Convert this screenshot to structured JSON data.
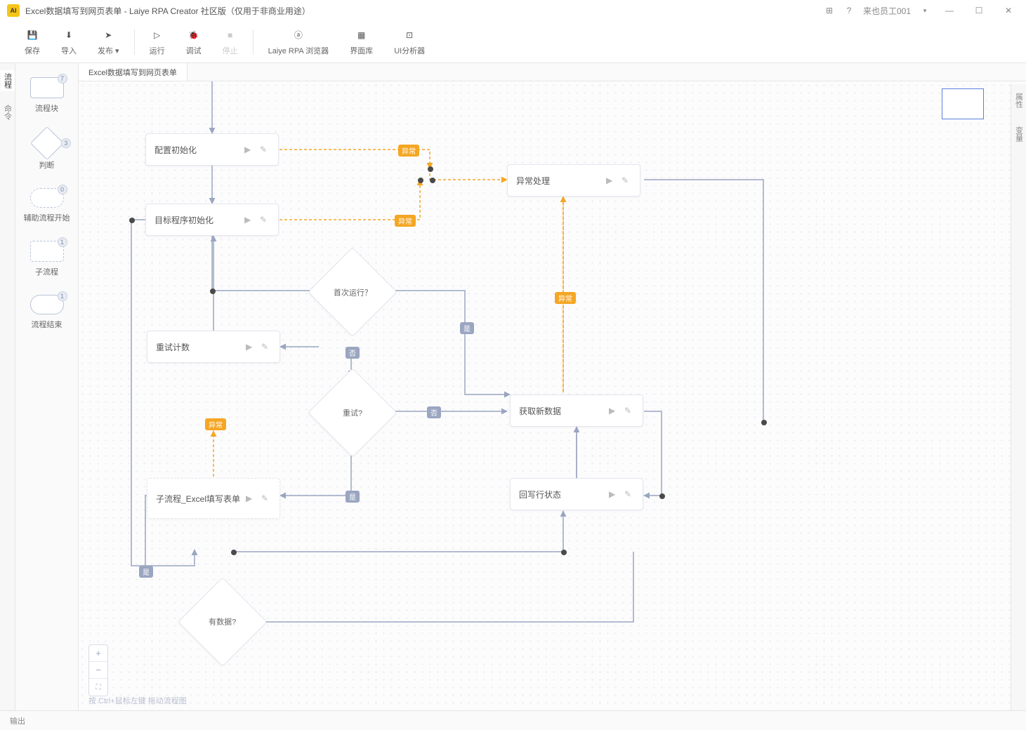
{
  "titlebar": {
    "title": "Excel数据填写到网页表单 - Laiye RPA Creator 社区版（仅用于非商业用途）",
    "user": "来也员工001"
  },
  "toolbar": {
    "save": "保存",
    "import": "导入",
    "publish": "发布",
    "run": "运行",
    "debug": "调试",
    "stop": "停止",
    "browser": "Laiye RPA 浏览器",
    "uilib": "界面库",
    "analyzer": "UI分析器"
  },
  "left_tabs": {
    "flow": "流程",
    "cmd": "命令"
  },
  "palette": {
    "block": {
      "label": "流程块",
      "badge": "7"
    },
    "decision": {
      "label": "判断",
      "badge": "3"
    },
    "aux": {
      "label": "辅助流程开始",
      "badge": "0"
    },
    "sub": {
      "label": "子流程",
      "badge": "1"
    },
    "end": {
      "label": "流程结束",
      "badge": "1"
    }
  },
  "tab": "Excel数据填写到网页表单",
  "nodes": {
    "config": "配置初始化",
    "target": "目标程序初始化",
    "exception": "异常处理",
    "first": "首次运行？",
    "retry_count": "重试计数",
    "retry": "重试?",
    "fetch": "获取新数据",
    "sub_excel": "子流程_Excel填写表单",
    "writeback": "回写行状态",
    "has_data": "有数据?"
  },
  "edge_labels": {
    "exc": "异常",
    "yes": "是",
    "no": "否"
  },
  "hint": "按 Ctrl+鼠标左键 拖动流程图",
  "bottom": "输出",
  "right_tabs": {
    "prop": "属性",
    "vars": "变量"
  }
}
